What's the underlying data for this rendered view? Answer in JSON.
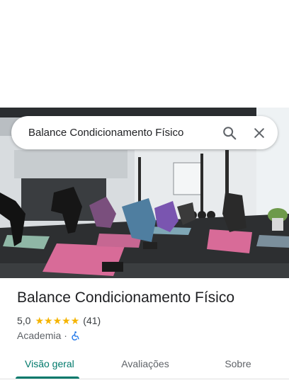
{
  "search": {
    "query": "Balance Condicionamento Físico"
  },
  "place": {
    "name": "Balance Condicionamento Físico",
    "rating": "5,0",
    "stars": 5,
    "review_count": "(41)",
    "category": "Academia",
    "separator": "·"
  },
  "tabs": [
    {
      "label": "Visão geral",
      "active": true
    },
    {
      "label": "Avaliações",
      "active": false
    },
    {
      "label": "Sobre",
      "active": false
    }
  ],
  "colors": {
    "accent": "#00796b",
    "star": "#f5b400",
    "accessibility": "#1a73e8"
  },
  "icons": [
    "search-icon",
    "close-icon",
    "star-icon",
    "wheelchair-accessible-icon"
  ]
}
